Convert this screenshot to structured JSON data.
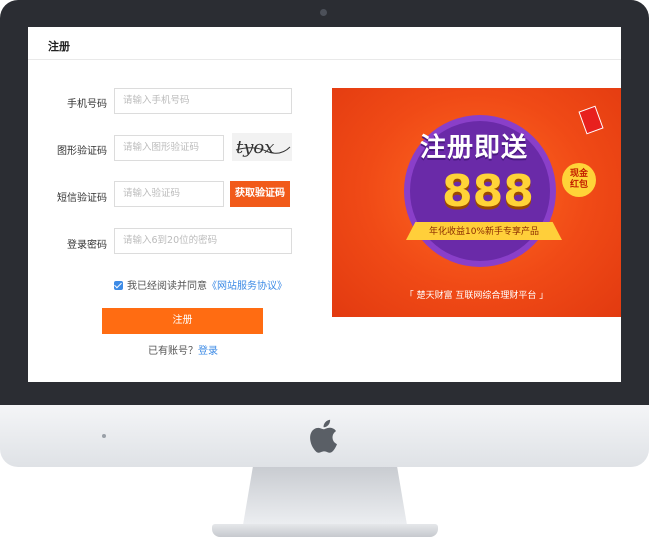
{
  "page": {
    "title": "注册"
  },
  "form": {
    "phone": {
      "label": "手机号码",
      "placeholder": "请输入手机号码"
    },
    "captcha": {
      "label": "图形验证码",
      "placeholder": "请输入图形验证码",
      "image_text": "tyox"
    },
    "sms": {
      "label": "短信验证码",
      "placeholder": "请输入验证码",
      "button": "获取验证码"
    },
    "password": {
      "label": "登录密码",
      "placeholder": "请输入6到20位的密码"
    },
    "agreement": {
      "checked": true,
      "text": "我已经阅读并同意",
      "link": "《网站服务协议》"
    },
    "submit": "注册",
    "login_prompt": "已有账号？",
    "login_link": "登录"
  },
  "banner": {
    "headline": "注册即送",
    "amount": "888",
    "badge_line1": "现金",
    "badge_line2": "红包",
    "ribbon": "年化收益10%新手专享产品",
    "footer": "「  楚天财富    互联网综合理财平台  」"
  },
  "colors": {
    "accent": "#ff6c12",
    "sms_button": "#f15a1a",
    "link": "#3d8be6",
    "bezel": "#2b2d33"
  }
}
